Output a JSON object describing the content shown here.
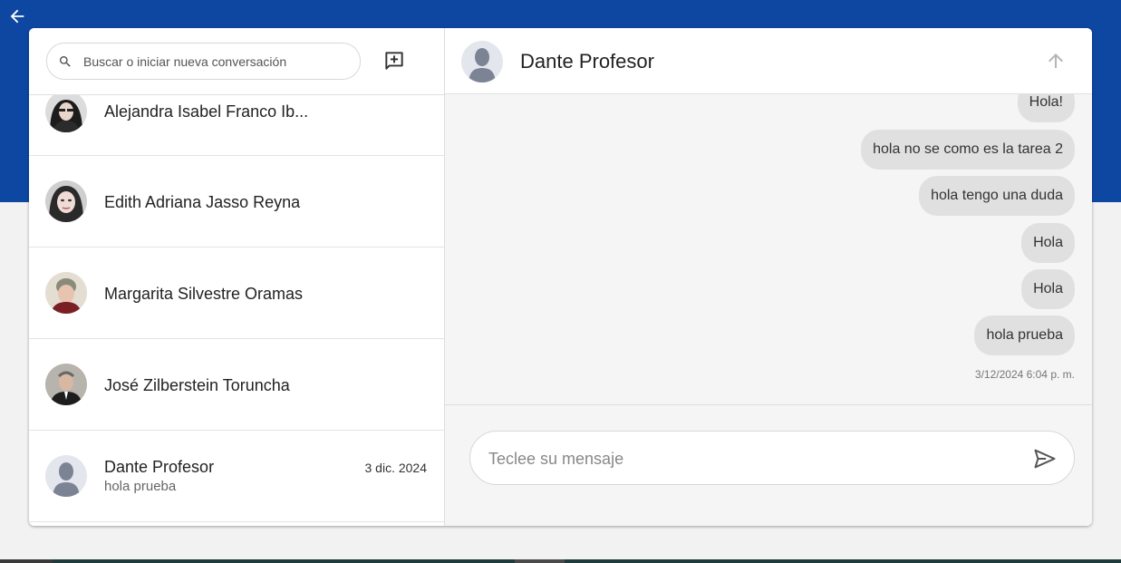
{
  "colors": {
    "brand": "#0d47a1",
    "bubble": "#e0e0e0",
    "panel": "#f5f5f5"
  },
  "search": {
    "placeholder": "Buscar o iniciar nueva conversación",
    "icon": "search-icon"
  },
  "new_chat": {
    "icon": "add-box-icon"
  },
  "conversations": [
    {
      "name": "Alejandra Isabel Franco Ib...",
      "date": "",
      "preview": ""
    },
    {
      "name": "Edith Adriana Jasso Reyna",
      "date": "",
      "preview": ""
    },
    {
      "name": "Margarita Silvestre Oramas",
      "date": "",
      "preview": ""
    },
    {
      "name": "José Zilberstein Toruncha",
      "date": "",
      "preview": ""
    },
    {
      "name": "Dante Profesor",
      "date": "3 dic. 2024",
      "preview": "hola prueba"
    }
  ],
  "chat": {
    "title": "Dante Profesor",
    "messages": [
      "Hola!",
      "hola no se como es la tarea 2",
      "hola tengo una duda",
      "Hola",
      "Hola",
      "hola prueba"
    ],
    "last_timestamp": "3/12/2024 6:04 p. m.",
    "composer_placeholder": "Teclee su mensaje"
  }
}
